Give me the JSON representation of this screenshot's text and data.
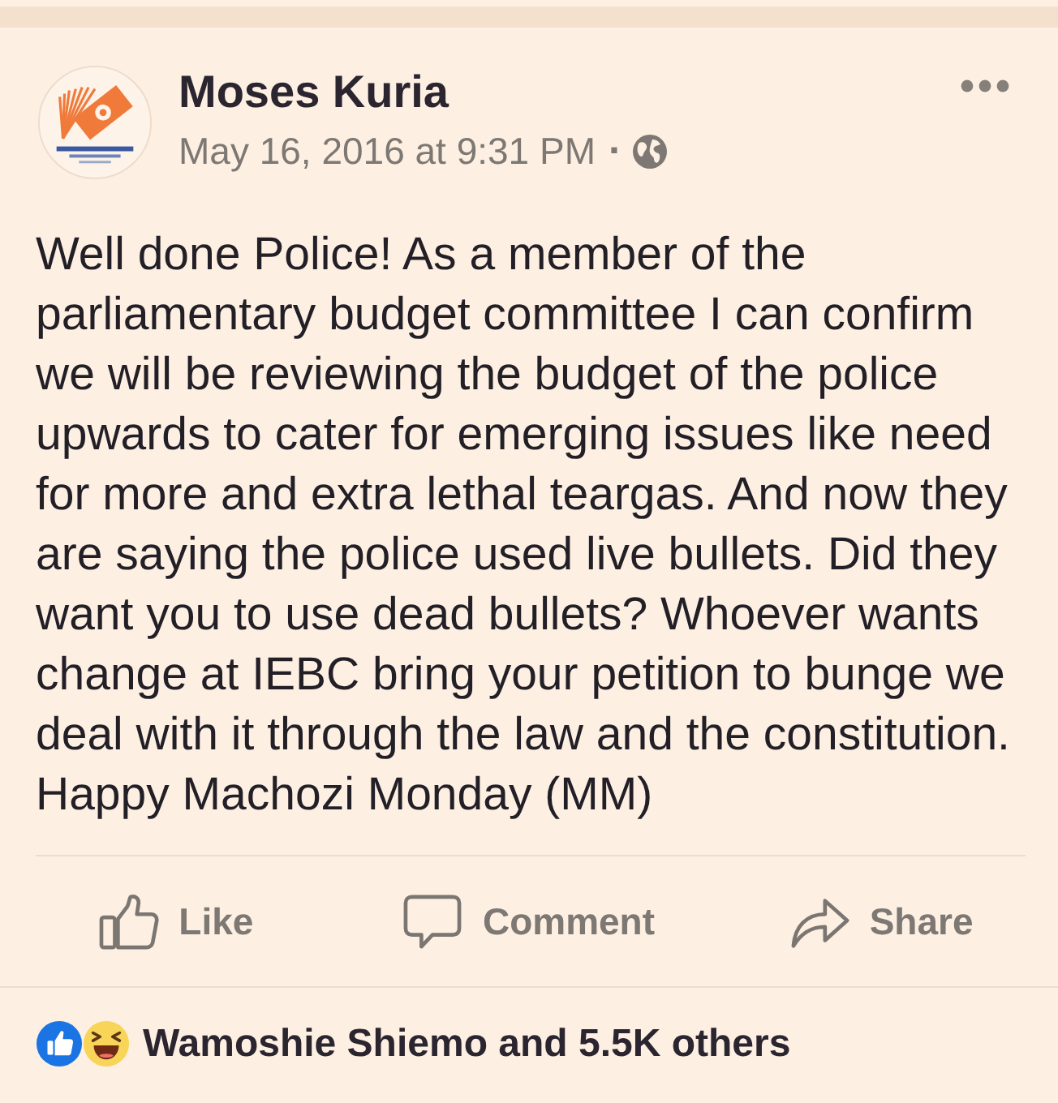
{
  "post": {
    "author": "Moses Kuria",
    "timestamp": "May 16, 2016 at 9:31 PM",
    "separator": "·",
    "public": true,
    "text": "Well done Police! As a member of the parliamentary budget committee I can confirm we will be reviewing the budget of the police upwards to cater for emerging issues like need for more and extra lethal teargas. And now they are saying the police used live bullets. Did they want you to use dead bullets? Whoever wants change at IEBC bring your petition to bunge we deal with it through the law and the constitution. Happy Machozi Monday (MM)"
  },
  "actions": [
    {
      "kind": "like",
      "label": "Like"
    },
    {
      "kind": "comment",
      "label": "Comment"
    },
    {
      "kind": "share",
      "label": "Share"
    }
  ],
  "reactions": {
    "icons": [
      {
        "kind": "like"
      },
      {
        "kind": "haha"
      }
    ],
    "summary": "Wamoshie Shiemo and 5.5K others"
  }
}
